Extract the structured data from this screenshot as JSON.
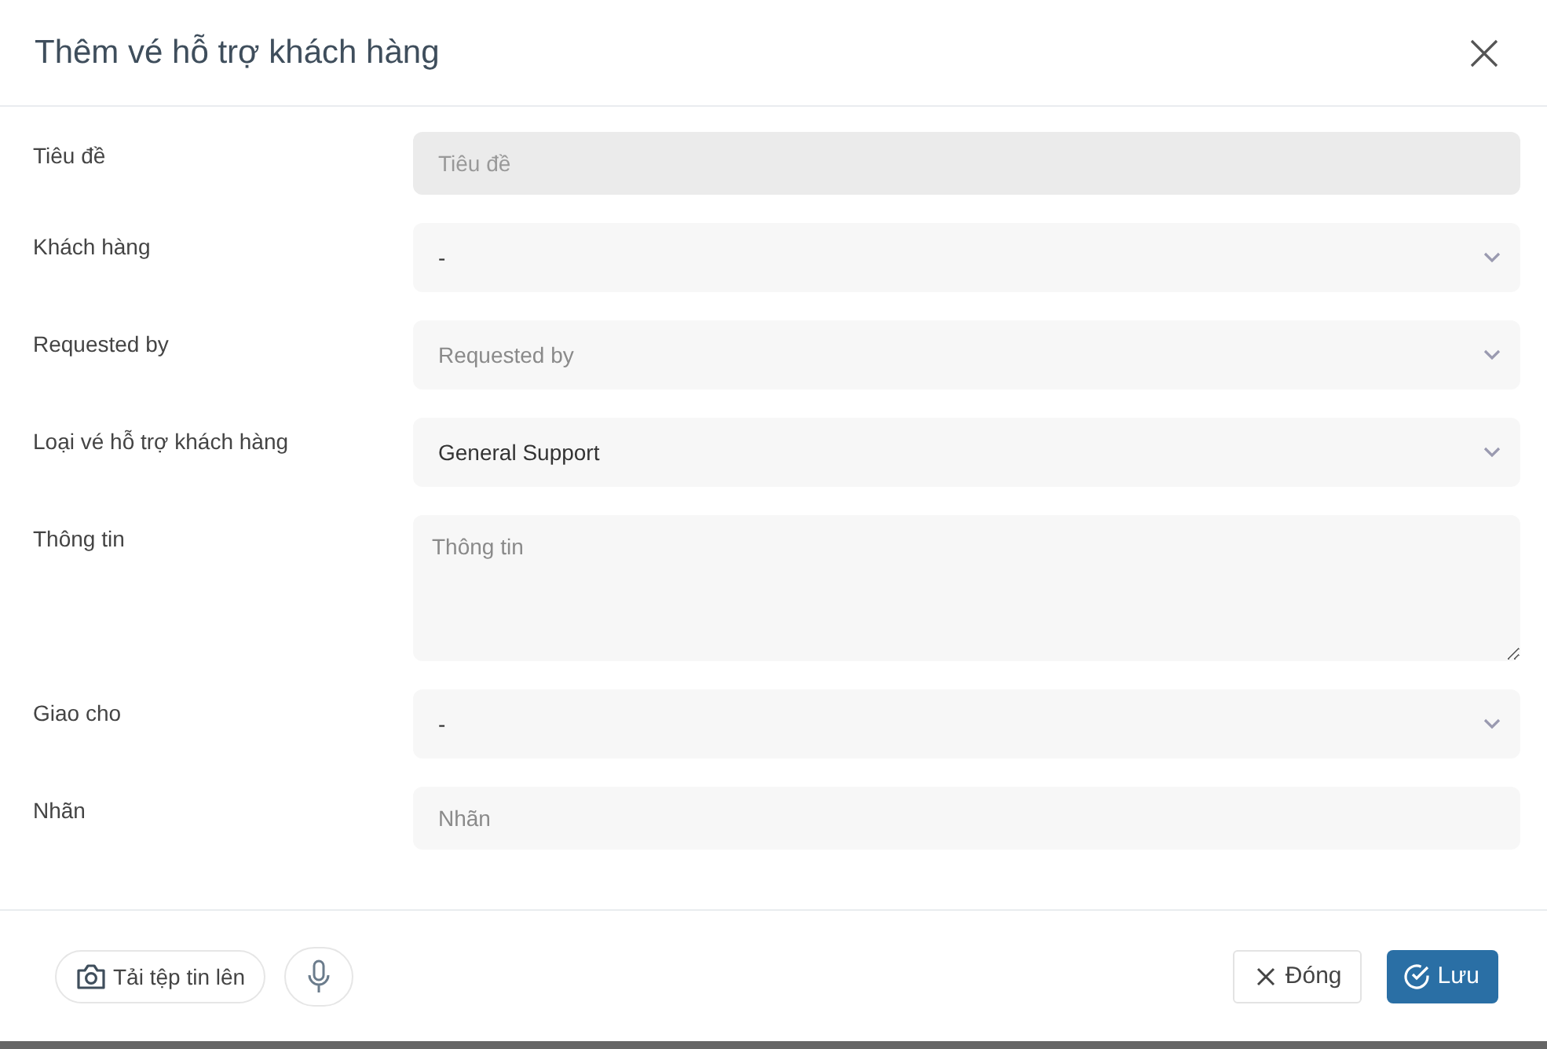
{
  "dialog": {
    "title": "Thêm vé hỗ trợ khách hàng"
  },
  "fields": [
    {
      "label": "Tiêu đề",
      "kind": "text",
      "placeholder": "Tiêu đề",
      "disabled": true
    },
    {
      "label": "Khách hàng",
      "kind": "select",
      "value": "-",
      "disabled": false
    },
    {
      "label": "Requested by",
      "kind": "select",
      "placeholder": "Requested by",
      "disabled": false
    },
    {
      "label": "Loại vé hỗ trợ khách hàng",
      "kind": "select",
      "value": "General Support",
      "disabled": false
    },
    {
      "label": "Thông tin",
      "kind": "textarea",
      "placeholder": "Thông tin",
      "disabled": false
    },
    {
      "label": "Giao cho",
      "kind": "select",
      "value": "-",
      "disabled": false
    },
    {
      "label": "Nhãn",
      "kind": "text",
      "placeholder": "Nhãn",
      "disabled": false
    }
  ],
  "footer": {
    "upload_label": "Tải tệp tin lên",
    "close_label": "Đóng",
    "save_label": "Lưu"
  }
}
